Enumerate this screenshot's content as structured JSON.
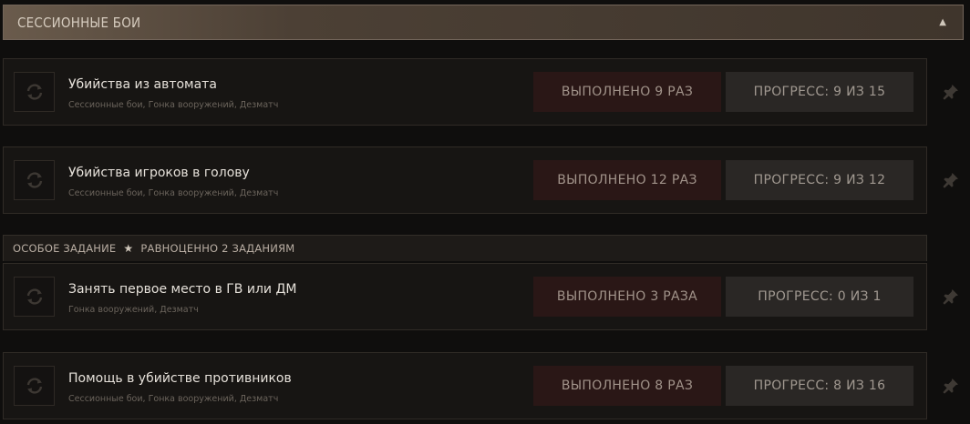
{
  "section": {
    "title": "СЕССИОННЫЕ БОИ",
    "toggle_icon": "caret-up-icon"
  },
  "tasks": [
    {
      "name": "Убийства из автомата",
      "modes": "Сессионные бои, Гонка вооружений, Дезматч",
      "done": "ВЫПОЛНЕНО 9 РАЗ",
      "progress": "ПРОГРЕСС: 9 ИЗ 15"
    },
    {
      "name": "Убийства игроков в голову",
      "modes": "Сессионные бои, Гонка вооружений, Дезматч",
      "done": "ВЫПОЛНЕНО 12 РАЗ",
      "progress": "ПРОГРЕСС: 9 ИЗ 12"
    },
    {
      "name": "Занять первое место в ГВ или ДМ",
      "modes": "Гонка вооружений, Дезматч",
      "done": "ВЫПОЛНЕНО 3 РАЗА",
      "progress": "ПРОГРЕСС: 0 ИЗ 1"
    },
    {
      "name": "Помощь в убийстве противников",
      "modes": "Сессионные бои, Гонка вооружений, Дезматч",
      "done": "ВЫПОЛНЕНО 8 РАЗ",
      "progress": "ПРОГРЕСС: 8 ИЗ 16"
    }
  ],
  "special": {
    "label": "ОСОБОЕ ЗАДАНИЕ",
    "equivalent": "РАВНОЦЕННО 2 ЗАДАНИЯМ"
  },
  "icons": {
    "task": "refresh-icon",
    "pin": "pin-icon",
    "special": "star-icon"
  },
  "colors": {
    "done_bg": "#2a1716",
    "progress_bg": "#2a2725",
    "header_bg": "#4c4035"
  }
}
